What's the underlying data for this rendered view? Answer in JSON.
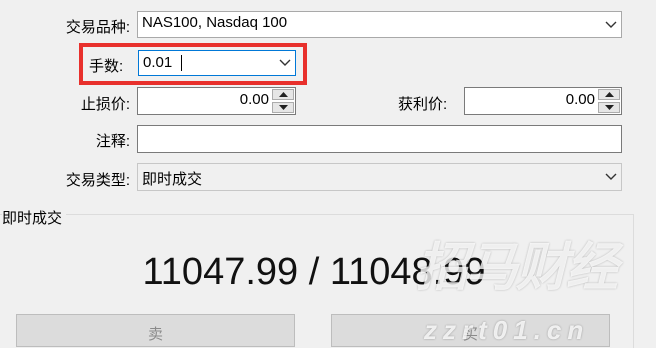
{
  "form": {
    "symbol_label": "交易品种:",
    "symbol_value": "NAS100, Nasdaq 100",
    "volume_label": "手数:",
    "volume_value": "0.01",
    "stoploss_label": "止损价:",
    "stoploss_value": "0.00",
    "takeprofit_label": "获利价:",
    "takeprofit_value": "0.00",
    "comment_label": "注释:",
    "comment_value": "",
    "type_label": "交易类型:",
    "type_value": "即时成交"
  },
  "execution": {
    "group_label": "即时成交",
    "price_display": "11047.99 / 11048.99"
  },
  "buttons": {
    "sell_label": "卖",
    "buy_label": "买"
  },
  "watermark": {
    "line1": "招马财经",
    "line2": "zzrt01.cn"
  },
  "colors": {
    "highlight_box": "#e8302c",
    "focus_border": "#0078d7"
  },
  "icons": [
    "chevron-down-icon",
    "spin-up-icon",
    "spin-down-icon"
  ]
}
